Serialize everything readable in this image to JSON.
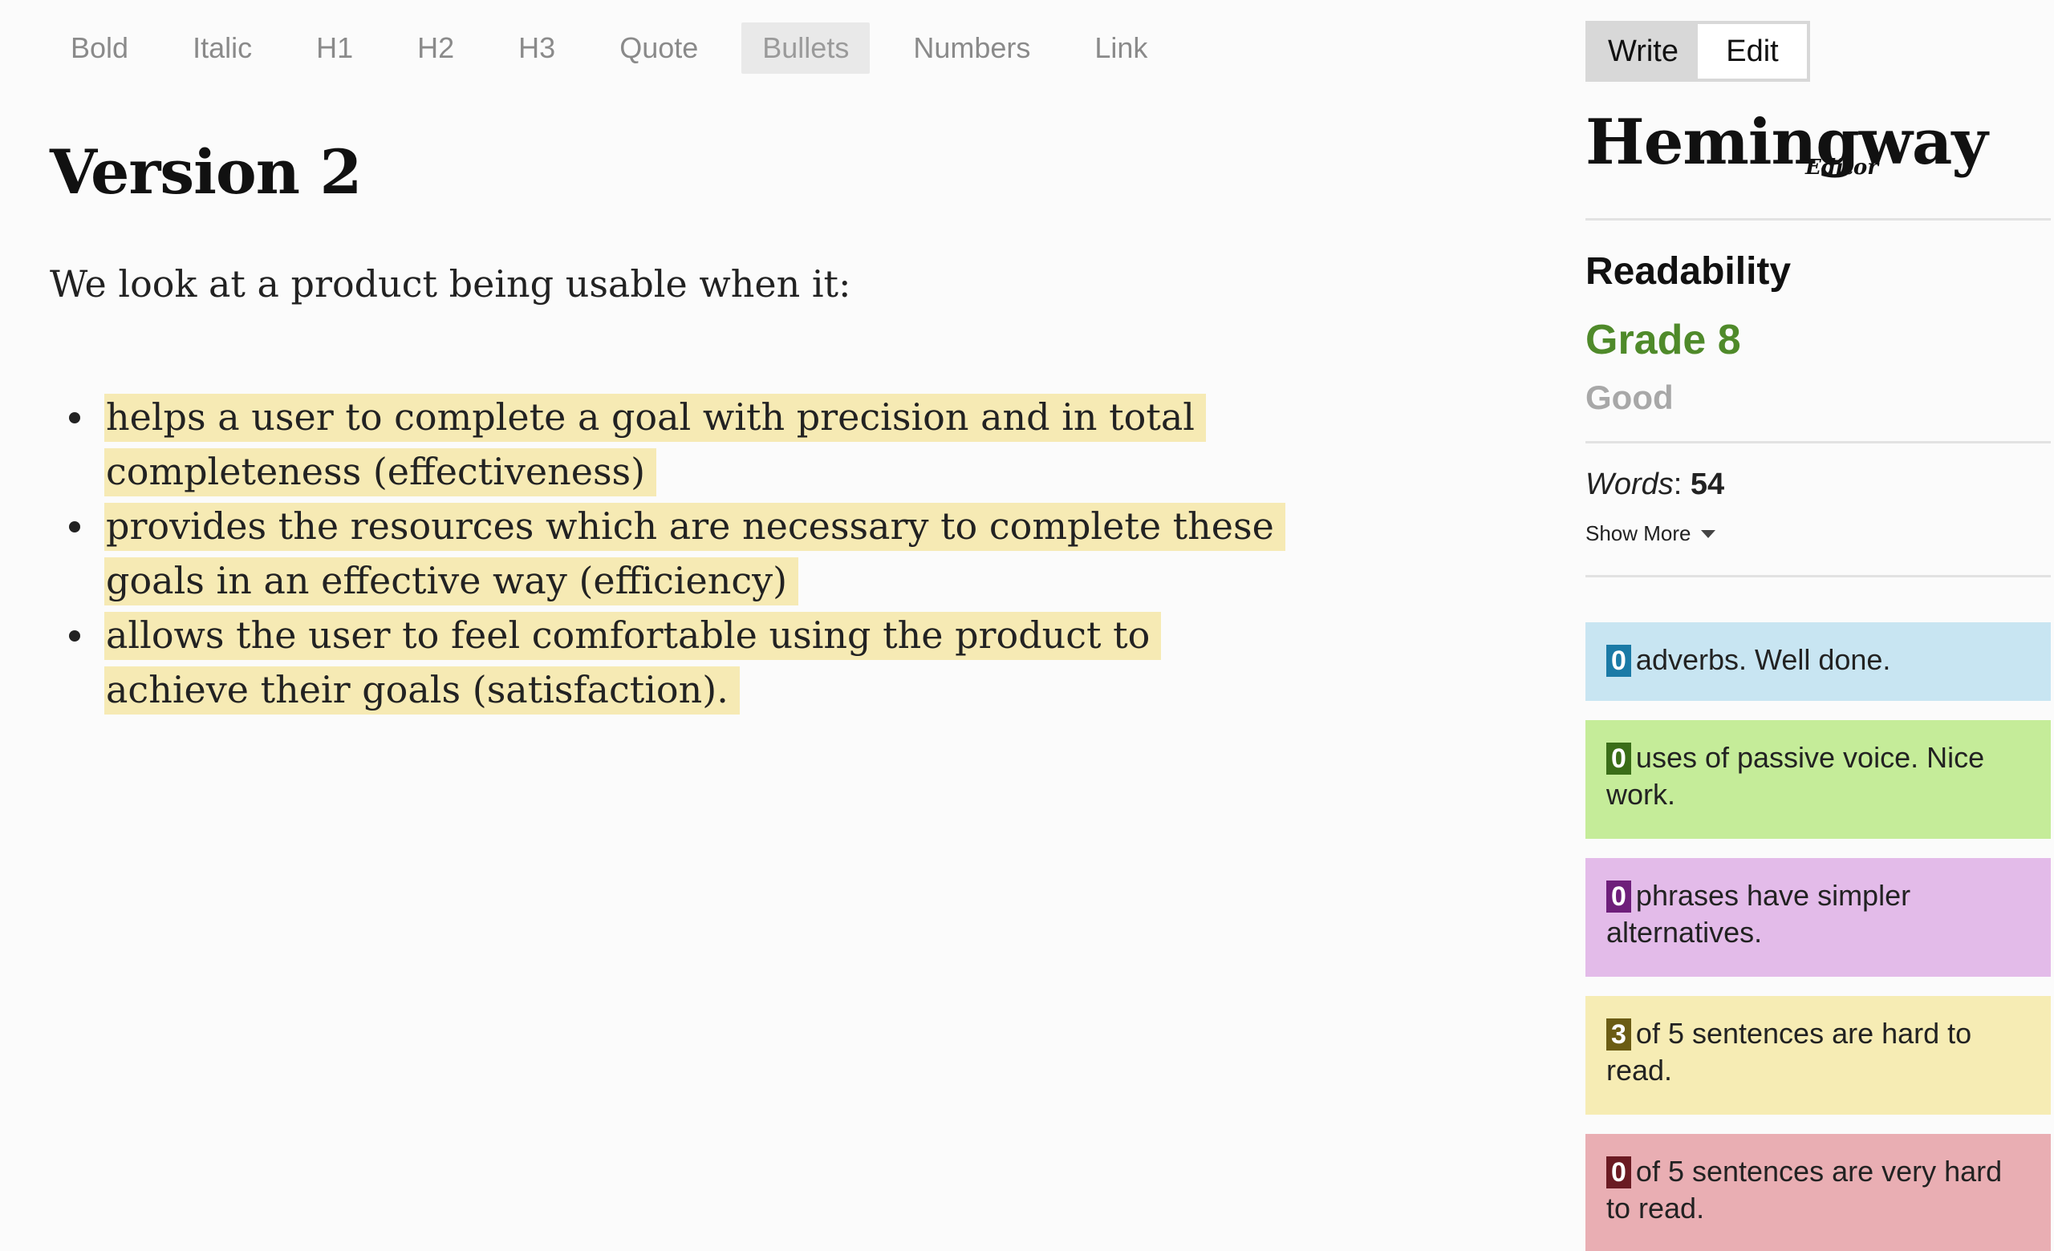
{
  "toolbar": {
    "items": [
      "Bold",
      "Italic",
      "H1",
      "H2",
      "H3",
      "Quote",
      "Bullets",
      "Numbers",
      "Link"
    ],
    "active": "Bullets"
  },
  "editor": {
    "title": "Version 2",
    "intro": "We look at a product being usable when it:",
    "bullets": [
      "helps a user to complete a goal with precision and in total completeness (effectiveness)",
      "provides the resources which are necessary to complete these goals in an effective way (efficiency)",
      "allows the user to feel comfortable using the product to achieve their goals (satisfaction)."
    ],
    "highlight_color": "#f6eab4"
  },
  "sidebar": {
    "mode_write": "Write",
    "mode_edit": "Edit",
    "brand_name": "Hemingway",
    "brand_sub": "Editor",
    "readability_label": "Readability",
    "grade": "Grade 8",
    "grade_desc": "Good",
    "words_label": "Words",
    "words_count": "54",
    "show_more": "Show More",
    "cards": {
      "adverbs": {
        "count": "0",
        "text": "adverbs. Well done."
      },
      "passive": {
        "count": "0",
        "text": "uses of passive voice. Nice work."
      },
      "phrases": {
        "count": "0",
        "text": "phrases have simpler alternatives."
      },
      "hard": {
        "count": "3",
        "text": "of 5 sentences are hard to read."
      },
      "vhard": {
        "count": "0",
        "text": "of 5 sentences are very hard to read."
      }
    },
    "colors": {
      "grade": "#4f8a2a",
      "adverbs": "#c8e5f2",
      "passive": "#c5ec99",
      "phrases": "#e3bbe9",
      "hard": "#f6ecb4",
      "very_hard": "#e9aeb3"
    },
    "icons": {
      "show_more": "caret-down-icon"
    }
  }
}
